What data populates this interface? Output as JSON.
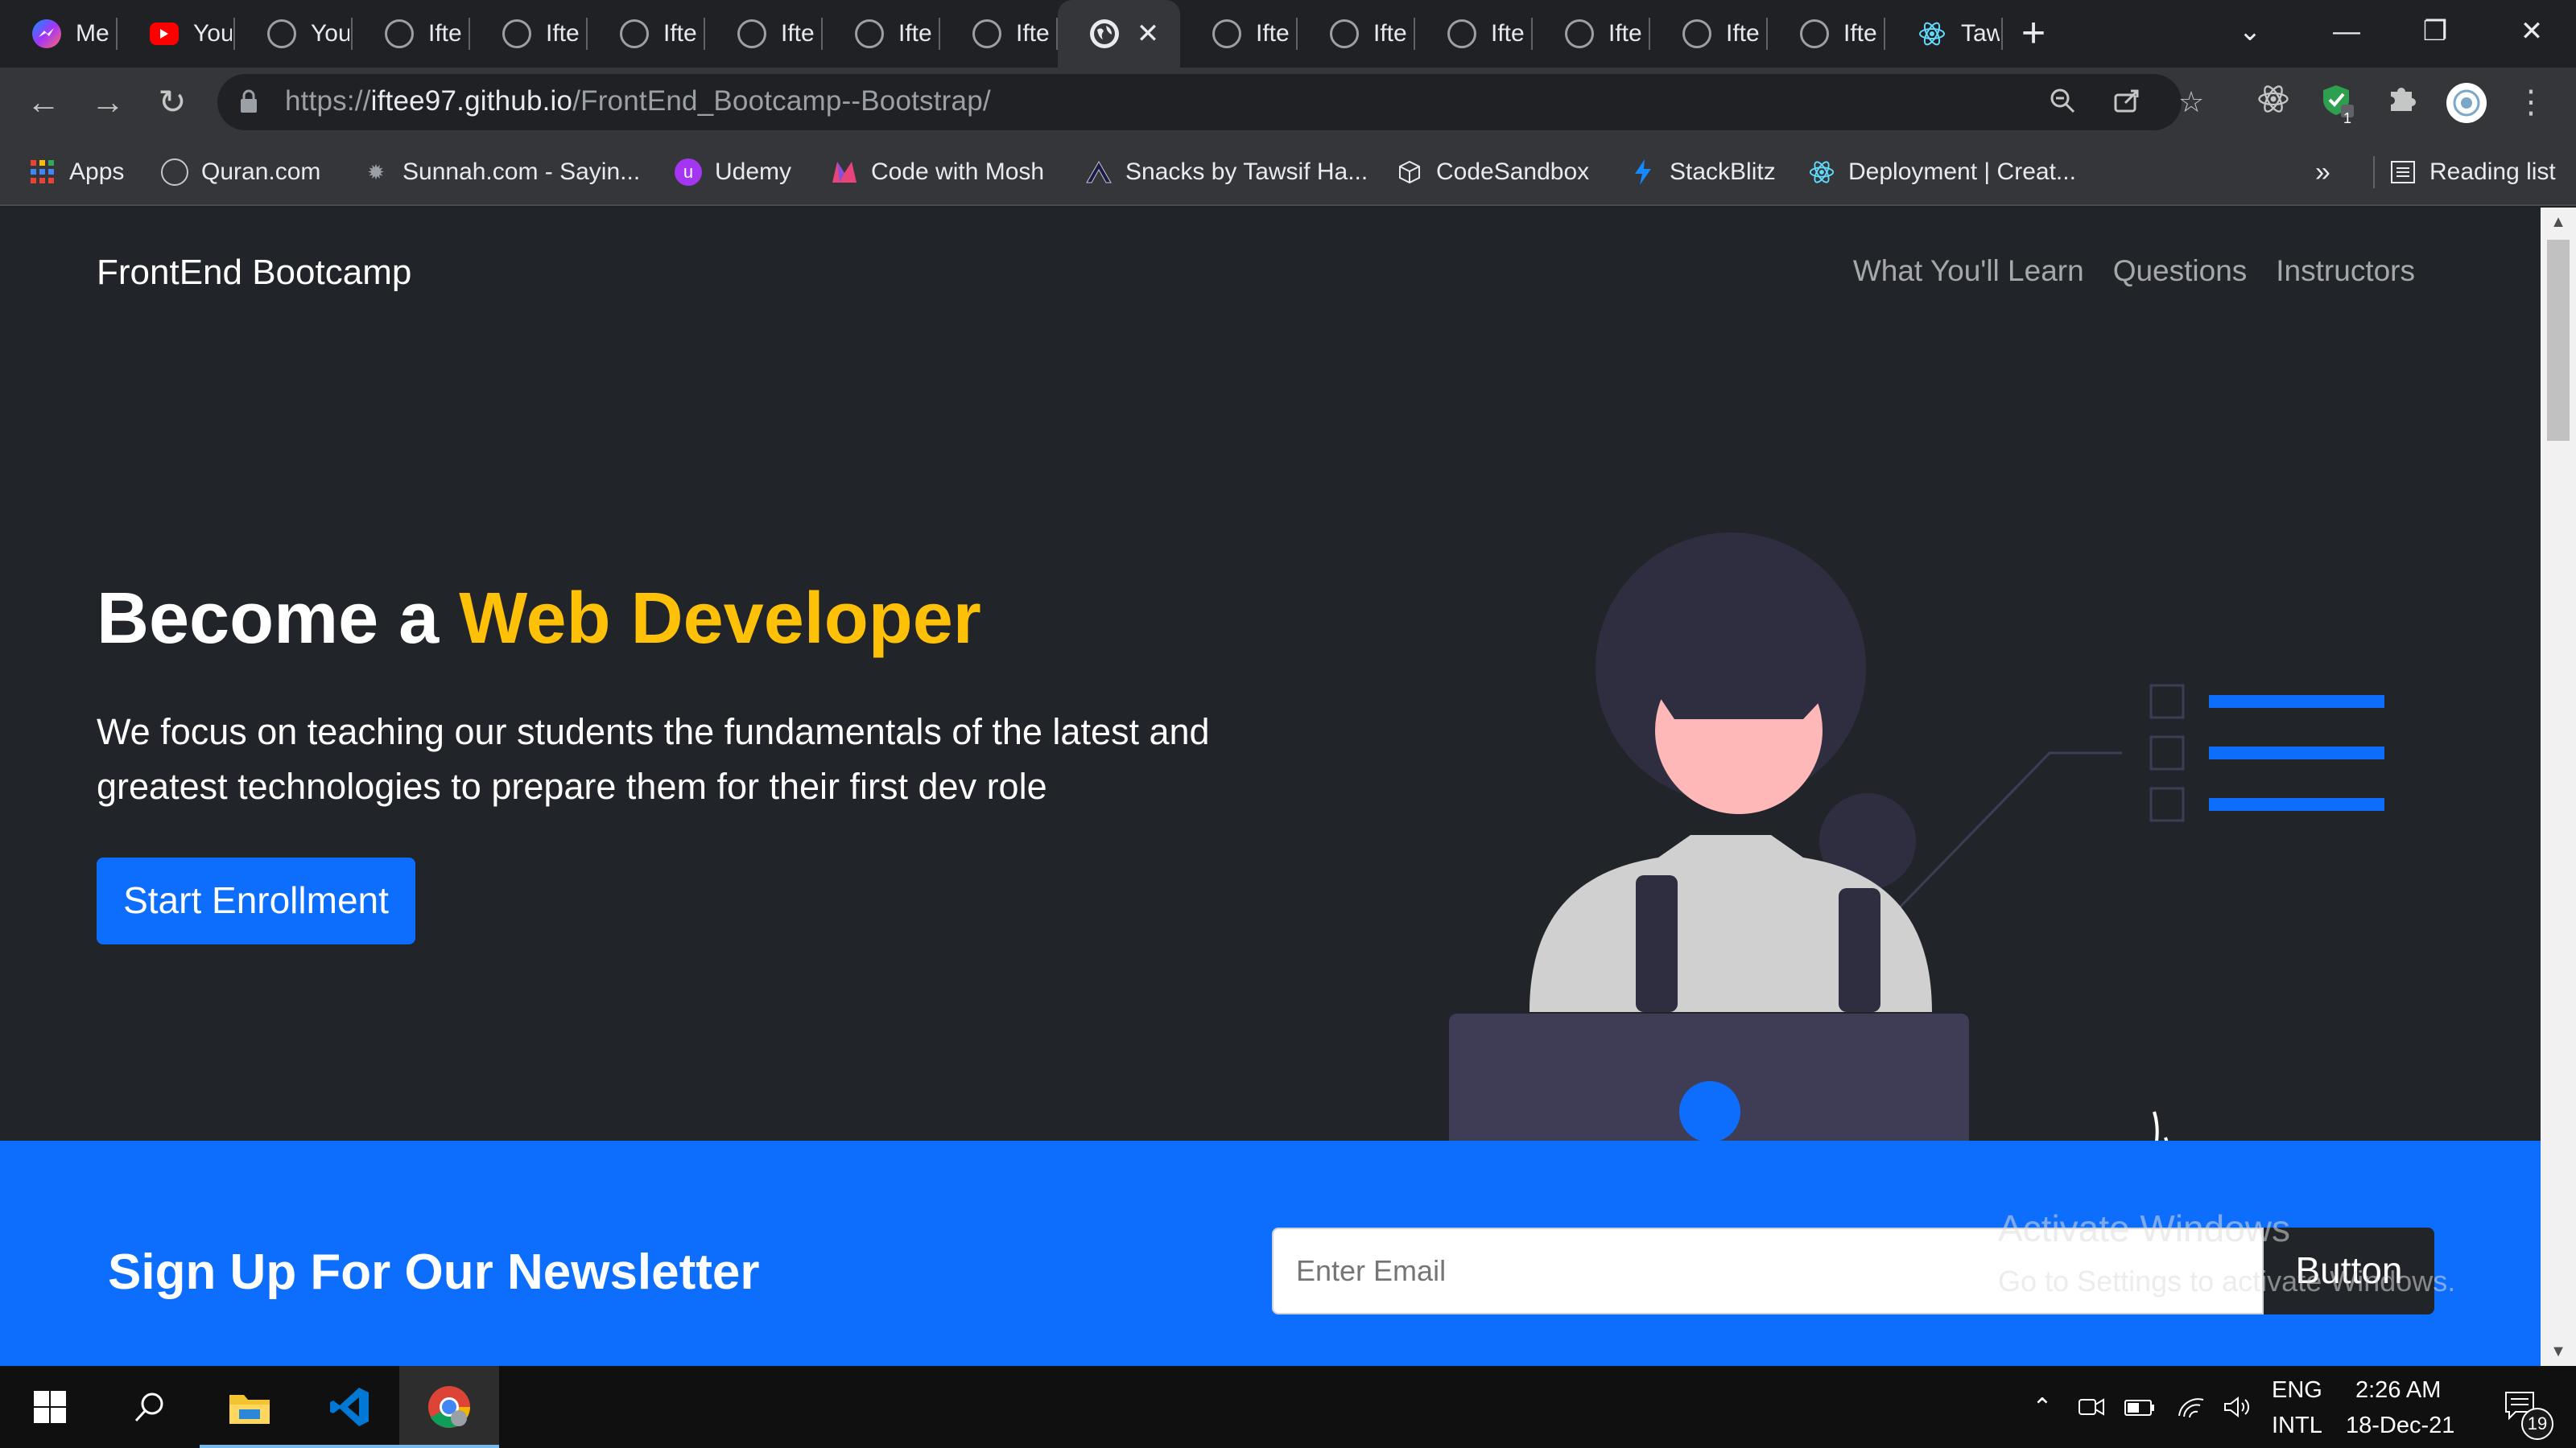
{
  "browser": {
    "tabs": [
      {
        "title": "Me",
        "icon": "messenger-icon",
        "active": false
      },
      {
        "title": "You",
        "icon": "youtube-icon",
        "active": false
      },
      {
        "title": "You",
        "icon": "github-icon",
        "active": false
      },
      {
        "title": "Ifte",
        "icon": "github-icon",
        "active": false
      },
      {
        "title": "Ifte",
        "icon": "github-icon",
        "active": false
      },
      {
        "title": "Ifte",
        "icon": "github-icon",
        "active": false
      },
      {
        "title": "Ifte",
        "icon": "github-icon",
        "active": false
      },
      {
        "title": "Ifte",
        "icon": "github-icon",
        "active": false
      },
      {
        "title": "Ifte",
        "icon": "github-icon",
        "active": false
      },
      {
        "title": "",
        "icon": "globe-icon",
        "active": true
      },
      {
        "title": "Ifte",
        "icon": "github-icon",
        "active": false
      },
      {
        "title": "Ifte",
        "icon": "github-icon",
        "active": false
      },
      {
        "title": "Ifte",
        "icon": "github-icon",
        "active": false
      },
      {
        "title": "Ifte",
        "icon": "github-icon",
        "active": false
      },
      {
        "title": "Ifte",
        "icon": "github-icon",
        "active": false
      },
      {
        "title": "Ifte",
        "icon": "github-icon",
        "active": false
      },
      {
        "title": "Taw",
        "icon": "react-icon",
        "active": false
      }
    ],
    "url_prefix": "https://",
    "url_host": "iftee97.github.io",
    "url_path": "/FrontEnd_Bootcamp--Bootstrap/",
    "bookmarks": [
      {
        "label": "Apps",
        "icon": "apps-grid-icon"
      },
      {
        "label": "Quran.com",
        "icon": "quran-icon"
      },
      {
        "label": "Sunnah.com - Sayin...",
        "icon": "sunnah-icon"
      },
      {
        "label": "Udemy",
        "icon": "udemy-icon"
      },
      {
        "label": "Code with Mosh",
        "icon": "mosh-icon"
      },
      {
        "label": "Snacks by Tawsif Ha...",
        "icon": "snacks-icon"
      },
      {
        "label": "CodeSandbox",
        "icon": "codesandbox-icon"
      },
      {
        "label": "StackBlitz",
        "icon": "stackblitz-icon"
      },
      {
        "label": "Deployment | Creat...",
        "icon": "react-icon"
      }
    ],
    "overflow_label": "»",
    "reading_list": "Reading list",
    "extension_badge": "1"
  },
  "site": {
    "brand": "FrontEnd Bootcamp",
    "nav": [
      "What You'll Learn",
      "Questions",
      "Instructors"
    ],
    "hero_title_plain": "Become a ",
    "hero_title_accent": "Web Developer",
    "hero_lead": "We focus on teaching our students the fundamentals of the latest and greatest technologies to prepare them for their first dev role",
    "enroll_button": "Start Enrollment",
    "newsletter_title": "Sign Up For Our Newsletter",
    "email_placeholder": "Enter Email",
    "newsletter_button": "Button"
  },
  "watermark": {
    "title": "Activate Windows",
    "subtitle": "Go to Settings to activate Windows."
  },
  "taskbar": {
    "lang_top": "ENG",
    "lang_bottom": "INTL",
    "time": "2:26 AM",
    "date": "18-Dec-21",
    "notification_count": "19"
  },
  "colors": {
    "page_bg": "#212529",
    "accent_yellow": "#ffc107",
    "primary_blue": "#0d6efd",
    "illustration_dark": "#3f3d56",
    "illustration_hair": "#2f2e41",
    "illustration_skin": "#ffb8b8"
  }
}
